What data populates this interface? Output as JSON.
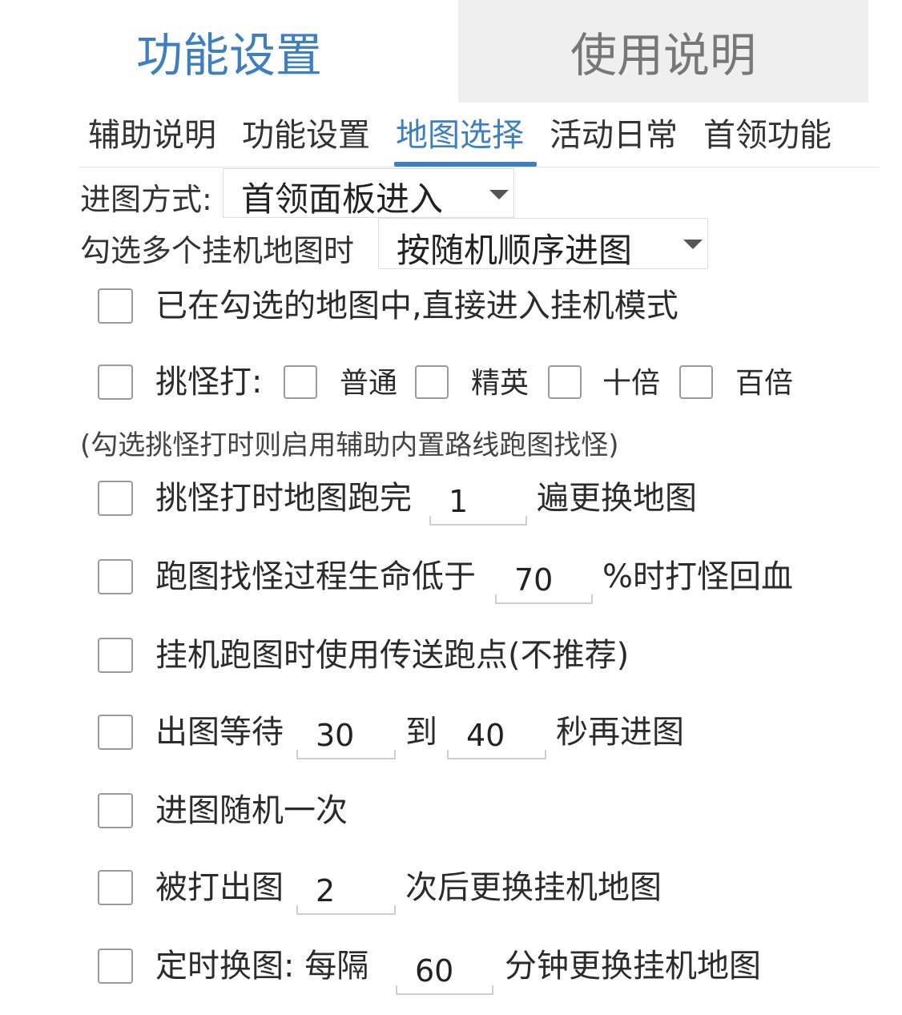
{
  "top_tabs": {
    "active": "功能设置",
    "inactive": "使用说明"
  },
  "sub_tabs": [
    "辅助说明",
    "功能设置",
    "地图选择",
    "活动日常",
    "首领功能"
  ],
  "entry_mode": {
    "label": "进图方式:",
    "value": "首领面板进入"
  },
  "multi_map": {
    "label": "勾选多个挂机地图时",
    "value": "按随机顺序进图"
  },
  "opt_direct": {
    "label": "已在勾选的地图中,直接进入挂机模式",
    "checked": false
  },
  "opt_pick": {
    "label": "挑怪打:",
    "checked": false,
    "types": [
      "普通",
      "精英",
      "十倍",
      "百倍"
    ]
  },
  "note": "(勾选挑怪打时则启用辅助内置路线跑图找怪)",
  "opt_laps": {
    "prefix": "挑怪打时地图跑完",
    "value": "1",
    "suffix": "遍更换地图",
    "checked": false
  },
  "opt_hp": {
    "prefix": "跑图找怪过程生命低于",
    "value": "70",
    "suffix": "%时打怪回血",
    "checked": false
  },
  "opt_teleport": {
    "label": "挂机跑图时使用传送跑点(不推荐)",
    "checked": false
  },
  "opt_wait": {
    "prefix": "出图等待",
    "from": "30",
    "mid": "到",
    "to": "40",
    "suffix": "秒再进图",
    "checked": false
  },
  "opt_random": {
    "label": "进图随机一次",
    "checked": false
  },
  "opt_killed": {
    "prefix": "被打出图",
    "value": "2",
    "suffix": "次后更换挂机地图",
    "checked": false
  },
  "opt_timer": {
    "prefix": "定时换图: 每隔",
    "value": "60",
    "suffix": "分钟更换挂机地图",
    "checked": false
  },
  "colors": {
    "accent": "#3d7fc1",
    "inactive_tab_bg": "#efefef"
  }
}
